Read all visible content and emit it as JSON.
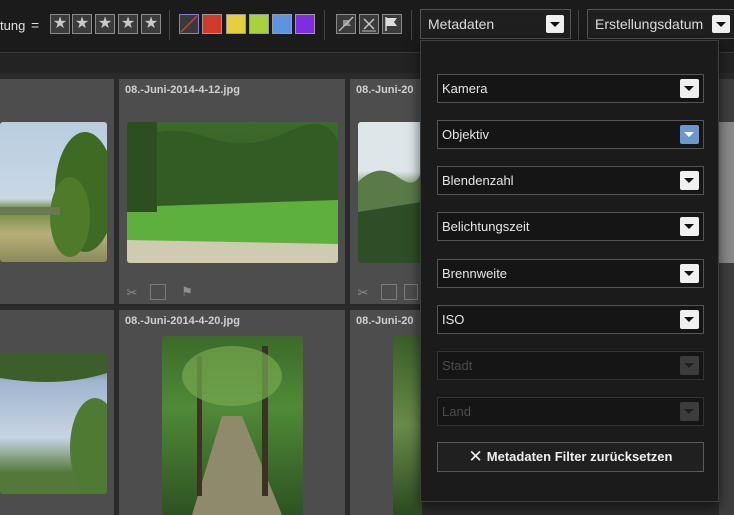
{
  "toolbar": {
    "rating_label": "tung",
    "rating_operator": "=",
    "stars": [
      "★",
      "★",
      "★",
      "★",
      "★"
    ],
    "color_labels": [
      {
        "name": "none",
        "color": "#3a3a3a"
      },
      {
        "name": "red",
        "color": "#d23a2a"
      },
      {
        "name": "yellow",
        "color": "#e6cf3c"
      },
      {
        "name": "green",
        "color": "#a7d13e"
      },
      {
        "name": "blue",
        "color": "#5c94e0"
      },
      {
        "name": "purple",
        "color": "#7d2fe0"
      }
    ],
    "flag_filters": [
      "unflagged-icon",
      "rejected-flag-icon",
      "picked-flag-icon"
    ],
    "metadata_select": "Metadaten",
    "sort_select": "Erstellungsdatum"
  },
  "grid": {
    "cells": [
      {
        "title": ""
      },
      {
        "title": "08.-Juni-2014-4-12.jpg"
      },
      {
        "title": "08.-Juni-20"
      },
      {
        "title": ""
      },
      {
        "title": "08.-Juni-2014-4-20.jpg"
      },
      {
        "title": "08.-Juni-20"
      }
    ]
  },
  "metadata_panel": {
    "fields": [
      {
        "label": "Kamera",
        "enabled": true
      },
      {
        "label": "Objektiv",
        "enabled": true
      },
      {
        "label": "Blendenzahl",
        "enabled": true
      },
      {
        "label": "Belichtungszeit",
        "enabled": true
      },
      {
        "label": "Brennweite",
        "enabled": true
      },
      {
        "label": "ISO",
        "enabled": true
      },
      {
        "label": "Stadt",
        "enabled": false
      },
      {
        "label": "Land",
        "enabled": false
      }
    ],
    "reset_button": "Metadaten Filter zurücksetzen"
  }
}
